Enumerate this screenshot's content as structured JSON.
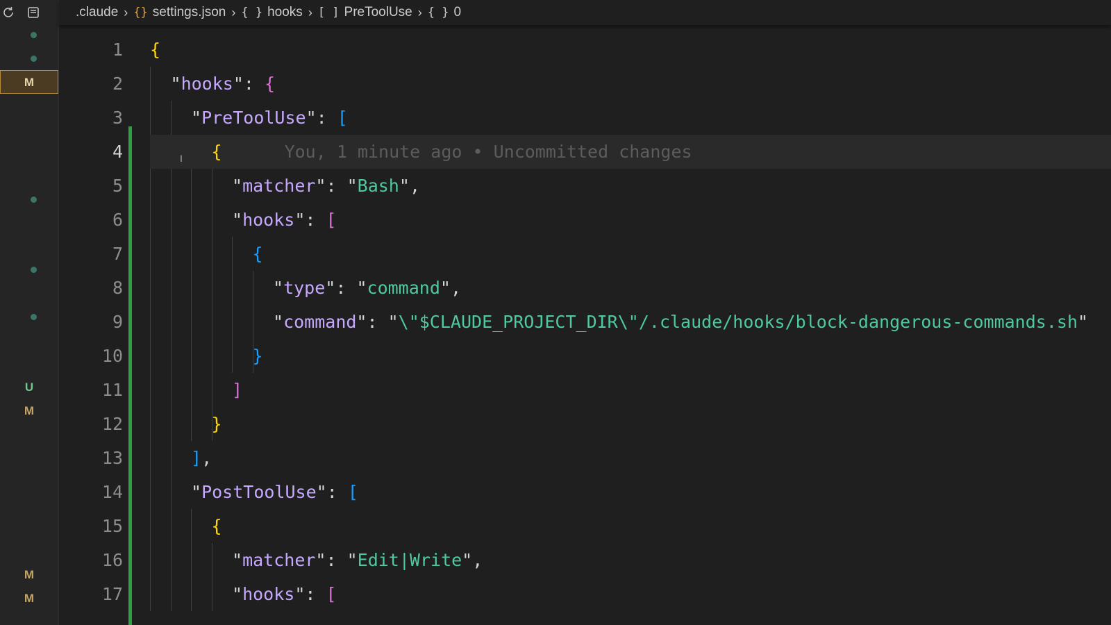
{
  "breadcrumb": {
    "items": [
      {
        "label": ".claude",
        "icon": ""
      },
      {
        "label": "settings.json",
        "icon": "{}"
      },
      {
        "label": "hooks",
        "icon": "{ }"
      },
      {
        "label": "PreToolUse",
        "icon": "[ ]"
      },
      {
        "label": "0",
        "icon": "{ }"
      }
    ]
  },
  "gutter_indicators": [
    {
      "type": "dot"
    },
    {
      "type": "dot"
    },
    {
      "type": "letter",
      "text": "M",
      "selected": true
    },
    {
      "type": "dot"
    },
    {
      "type": "dot"
    },
    {
      "type": "dot"
    },
    {
      "type": "letter",
      "text": "U"
    },
    {
      "type": "letter",
      "text": "M"
    },
    {
      "type": "letter",
      "text": "M"
    },
    {
      "type": "letter",
      "text": "M"
    }
  ],
  "editor": {
    "current_line": 4,
    "blame_text": "You, 1 minute ago • Uncommitted changes",
    "lines": [
      {
        "n": "1",
        "indent": 0,
        "tokens": [
          [
            "b1",
            "{"
          ]
        ]
      },
      {
        "n": "2",
        "indent": 1,
        "tokens": [
          [
            "q",
            "\""
          ],
          [
            "k",
            "hooks"
          ],
          [
            "q",
            "\""
          ],
          [
            "p",
            ": "
          ],
          [
            "b2",
            "{"
          ]
        ]
      },
      {
        "n": "3",
        "indent": 2,
        "tokens": [
          [
            "q",
            "\""
          ],
          [
            "k",
            "PreToolUse"
          ],
          [
            "q",
            "\""
          ],
          [
            "p",
            ": "
          ],
          [
            "b3",
            "["
          ]
        ]
      },
      {
        "n": "4",
        "indent": 3,
        "tokens": [
          [
            "b1",
            "{"
          ]
        ]
      },
      {
        "n": "5",
        "indent": 4,
        "tokens": [
          [
            "q",
            "\""
          ],
          [
            "k",
            "matcher"
          ],
          [
            "q",
            "\""
          ],
          [
            "p",
            ": "
          ],
          [
            "q",
            "\""
          ],
          [
            "s",
            "Bash"
          ],
          [
            "q",
            "\""
          ],
          [
            "p",
            ","
          ]
        ]
      },
      {
        "n": "6",
        "indent": 4,
        "tokens": [
          [
            "q",
            "\""
          ],
          [
            "k",
            "hooks"
          ],
          [
            "q",
            "\""
          ],
          [
            "p",
            ": "
          ],
          [
            "b2",
            "["
          ]
        ]
      },
      {
        "n": "7",
        "indent": 5,
        "tokens": [
          [
            "b3",
            "{"
          ]
        ]
      },
      {
        "n": "8",
        "indent": 6,
        "tokens": [
          [
            "q",
            "\""
          ],
          [
            "k",
            "type"
          ],
          [
            "q",
            "\""
          ],
          [
            "p",
            ": "
          ],
          [
            "q",
            "\""
          ],
          [
            "s",
            "command"
          ],
          [
            "q",
            "\""
          ],
          [
            "p",
            ","
          ]
        ]
      },
      {
        "n": "9",
        "indent": 6,
        "tokens": [
          [
            "q",
            "\""
          ],
          [
            "k",
            "command"
          ],
          [
            "q",
            "\""
          ],
          [
            "p",
            ": "
          ],
          [
            "q",
            "\""
          ],
          [
            "s",
            "\\\"$CLAUDE_PROJECT_DIR\\\"/.claude/hooks/block-dangerous-commands.sh"
          ],
          [
            "q",
            "\""
          ]
        ]
      },
      {
        "n": "10",
        "indent": 5,
        "tokens": [
          [
            "b3",
            "}"
          ]
        ]
      },
      {
        "n": "11",
        "indent": 4,
        "tokens": [
          [
            "b2",
            "]"
          ]
        ]
      },
      {
        "n": "12",
        "indent": 3,
        "tokens": [
          [
            "b1",
            "}"
          ]
        ]
      },
      {
        "n": "13",
        "indent": 2,
        "tokens": [
          [
            "b3",
            "]"
          ],
          [
            "p",
            ","
          ]
        ]
      },
      {
        "n": "14",
        "indent": 2,
        "tokens": [
          [
            "q",
            "\""
          ],
          [
            "k",
            "PostToolUse"
          ],
          [
            "q",
            "\""
          ],
          [
            "p",
            ": "
          ],
          [
            "b3",
            "["
          ]
        ]
      },
      {
        "n": "15",
        "indent": 3,
        "tokens": [
          [
            "b1",
            "{"
          ]
        ]
      },
      {
        "n": "16",
        "indent": 4,
        "tokens": [
          [
            "q",
            "\""
          ],
          [
            "k",
            "matcher"
          ],
          [
            "q",
            "\""
          ],
          [
            "p",
            ": "
          ],
          [
            "q",
            "\""
          ],
          [
            "s",
            "Edit|Write"
          ],
          [
            "q",
            "\""
          ],
          [
            "p",
            ","
          ]
        ]
      },
      {
        "n": "17",
        "indent": 4,
        "tokens": [
          [
            "q",
            "\""
          ],
          [
            "k",
            "hooks"
          ],
          [
            "q",
            "\""
          ],
          [
            "p",
            ": "
          ],
          [
            "b2",
            "["
          ]
        ]
      }
    ]
  }
}
